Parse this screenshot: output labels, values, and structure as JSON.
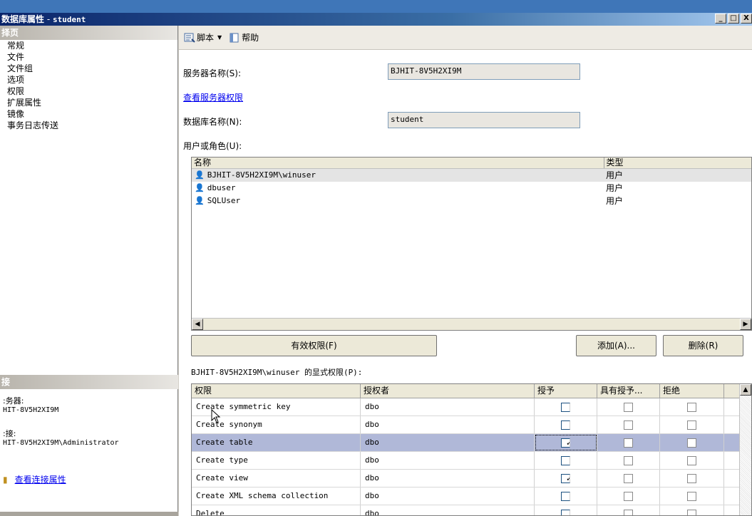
{
  "window": {
    "title": "数据库属性",
    "separator": " - ",
    "database": "student",
    "buttons": [
      "_",
      "□",
      "X"
    ]
  },
  "left_pane": {
    "header": "择页",
    "items": [
      "常规",
      "文件",
      "文件组",
      "选项",
      "权限",
      "扩展属性",
      "镜像",
      "事务日志传送"
    ],
    "connection_header": "接",
    "server_label": ":务器:",
    "server_value": "HIT-8V5H2XI9M",
    "connection_label": ":接:",
    "connection_value": "HIT-8V5H2XI9M\\Administrator",
    "view_connection_link": "查看连接属性"
  },
  "toolbar": {
    "script_label": "脚本",
    "help_label": "帮助"
  },
  "form": {
    "server_name_label": "服务器名称(S):",
    "server_name_value": "BJHIT-8V5H2XI9M",
    "view_server_permissions_link": "查看服务器权限",
    "database_name_label": "数据库名称(N):",
    "database_name_value": "student",
    "users_roles_label": "用户或角色(U):"
  },
  "users_list": {
    "columns": [
      "名称",
      "类型"
    ],
    "rows": [
      {
        "name": "BJHIT-8V5H2XI9M\\winuser",
        "type": "用户",
        "selected": true
      },
      {
        "name": "dbuser",
        "type": "用户",
        "selected": false
      },
      {
        "name": "SQLUser",
        "type": "用户",
        "selected": false
      }
    ]
  },
  "buttons": {
    "effective_permissions": "有效权限(F)",
    "add": "添加(A)...",
    "remove": "删除(R)"
  },
  "explicit_permissions_label": "BJHIT-8V5H2XI9M\\winuser 的显式权限(P):",
  "permissions_grid": {
    "columns": [
      "权限",
      "授权者",
      "授予",
      "具有授予...",
      "拒绝"
    ],
    "rows": [
      {
        "permission": "Create symmetric key",
        "grantor": "dbo",
        "grant": false,
        "with_grant": false,
        "deny": false
      },
      {
        "permission": "Create synonym",
        "grantor": "dbo",
        "grant": false,
        "with_grant": false,
        "deny": false
      },
      {
        "permission": "Create table",
        "grantor": "dbo",
        "grant": true,
        "with_grant": false,
        "deny": false,
        "selected": true
      },
      {
        "permission": "Create type",
        "grantor": "dbo",
        "grant": false,
        "with_grant": false,
        "deny": false
      },
      {
        "permission": "Create view",
        "grantor": "dbo",
        "grant": true,
        "with_grant": false,
        "deny": false
      },
      {
        "permission": "Create XML schema collection",
        "grantor": "dbo",
        "grant": false,
        "with_grant": false,
        "deny": false
      },
      {
        "permission": "Delete",
        "grantor": "dbo",
        "grant": false,
        "with_grant": false,
        "deny": false
      }
    ]
  },
  "colors": {
    "title_bar": "#0a246a",
    "selected_row": "#b0b8d8",
    "link": "#0000ee"
  }
}
